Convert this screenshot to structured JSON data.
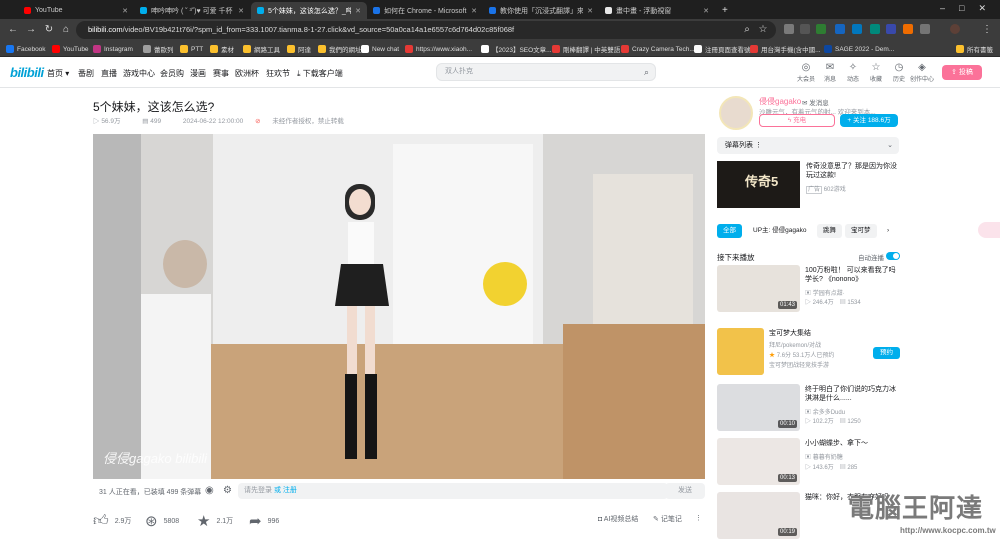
{
  "browser": {
    "tabs": [
      {
        "title": "YouTube",
        "color": "#ff0000",
        "active": false
      },
      {
        "title": "呻吟呻吟 ( ˘ ³˘)♥ 可爱 千杯 - bi...",
        "color": "#00aeec",
        "active": false
      },
      {
        "title": "5个妹妹，这该怎么选？_哔...",
        "color": "#00aeec",
        "active": true
      },
      {
        "title": "如何在 Chrome - Microsoft Edge",
        "color": "#1a73e8",
        "active": false
      },
      {
        "title": "教你使用「沉浸式翻譯」來翻譯...",
        "color": "#1a73e8",
        "active": false
      },
      {
        "title": "畫中畫 - 浮動視窗",
        "color": "#ffffff",
        "active": false
      }
    ],
    "url_host": "bilibili.com",
    "url_path": "/video/BV19b421t76i/?spm_id_from=333.1007.tianma.8-1-27.click&vd_source=50a0ca14a1e6557c6d764d02c85f068f",
    "bookmarks": [
      "Facebook",
      "YouTube",
      "Instagram",
      "蕾歐列",
      "PTT",
      "素材",
      "網路工具",
      "阿達",
      "我們的網址",
      "New chat",
      "https://www.xiaoh...",
      "【2023】SEO文章...",
      "剛棒翻譯 | 中英雙語",
      "Crazy Camera Tech...",
      "注冊頁面查看號",
      "用台灣手機(含中國...",
      "SAGE 2022 - Dem..."
    ],
    "all_bookmarks": "所有書籤"
  },
  "site": {
    "logo": "bilibili",
    "nav": [
      "首页",
      "番剧",
      "直播",
      "游戏中心",
      "会员购",
      "漫画",
      "赛事",
      "欧洲杯",
      "狂欢节",
      "下载客户端"
    ],
    "search_placeholder": "双人扑克",
    "header_icons": [
      {
        "label": "大会员",
        "icon": "vip-icon"
      },
      {
        "label": "消息",
        "icon": "message-icon"
      },
      {
        "label": "动态",
        "icon": "dynamic-icon"
      },
      {
        "label": "收藏",
        "icon": "favorite-icon"
      },
      {
        "label": "历史",
        "icon": "history-icon"
      },
      {
        "label": "创作中心",
        "icon": "creator-icon"
      }
    ],
    "upload": "投稿"
  },
  "video": {
    "title": "5个妹妹，这该怎么选?",
    "views": "56.9万",
    "danmaku_count": "499",
    "date": "2024-06-22 12:00:00",
    "copyright": "未经作者授权，禁止转载",
    "watermark": "侵侵gagako bilibili",
    "watching": "31 人正在看，已装填 499 条弹幕",
    "danmu_placeholder": "请先登录",
    "danmu_login": "或 注册",
    "send": "发送",
    "likes": "2.9万",
    "coins": "5808",
    "favorites": "2.1万",
    "shares": "996",
    "ai_summary": "AI视频总结",
    "notes": "记笔记"
  },
  "uploader": {
    "name": "侵侵gagako",
    "message": "发消息",
    "desc": "沙雕元气，有着元气的射...  欢迎来到本...",
    "charge": "充电",
    "follow": "+ 关注 188.6万"
  },
  "sidebar": {
    "danmaku_list": "弹幕列表",
    "ad": {
      "title": "传奇没意思了？那是因为你没玩过这款!",
      "sub": "602游戏",
      "thumb_text": "传奇5"
    },
    "tabs": [
      "全部",
      "UP主: 侵侵gagako",
      "跳舞",
      "宝可梦"
    ],
    "next_play": "接下来播放",
    "autoplay": "自动连播",
    "recs": [
      {
        "title": "100万粉啦！ 可以来看我了吗学长? 《nonono》",
        "author": "学园有点甜·",
        "views": "246.4万",
        "dm": "1534",
        "dur": "01:43"
      },
      {
        "title": "宝可梦大集结",
        "author": "拜尼/pokemon/对战",
        "views": "7.6分  53.1万人已预约",
        "dm": "",
        "dur": ""
      },
      {
        "title": "终于明白了你们说的巧克力冰淇淋是什么......",
        "author": "余多多Dudu",
        "views": "102.2万",
        "dm": "1250",
        "dur": "00:10"
      },
      {
        "title": "小小蝴蝶步、拿下～",
        "author": "暮暮有奶糖",
        "views": "143.6万",
        "dm": "285",
        "dur": "00:13"
      },
      {
        "title": "猫咪：你好，衣服有穿好吗",
        "author": "",
        "views": "",
        "dm": "",
        "dur": "00:19"
      }
    ],
    "order": "预约",
    "rec2_extra": "宝可梦团战轻竞技手游"
  },
  "watermark_brand": {
    "big": "電腦王阿達",
    "small": "http://www.kocpc.com.tw"
  },
  "colors": {
    "accent": "#00aeec",
    "pink": "#fb7299",
    "bg_dark": "#3c3c3c"
  }
}
